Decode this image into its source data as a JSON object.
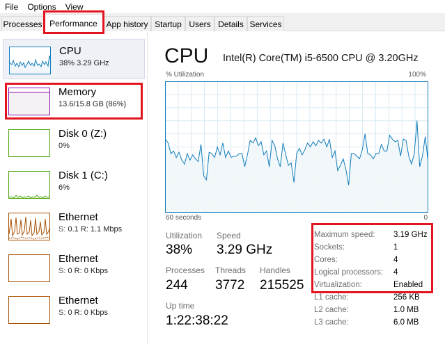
{
  "menu": {
    "items": [
      "File",
      "Options",
      "View"
    ]
  },
  "tabs": [
    "Processes",
    "Performance",
    "App history",
    "Startup",
    "Users",
    "Details",
    "Services"
  ],
  "active_tab": "Performance",
  "sidebar": {
    "items": [
      {
        "name": "CPU",
        "sub_value": "38%  3.29 GHz",
        "sub_label": "",
        "color": "#117dbb"
      },
      {
        "name": "Memory",
        "sub_value": "13.6/15.8 GB (86%)",
        "sub_label": "",
        "color": "#8b12ae"
      },
      {
        "name": "Disk 0 (Z:)",
        "sub_value": "0%",
        "sub_label": "",
        "color": "#4da60c"
      },
      {
        "name": "Disk 1 (C:)",
        "sub_value": "6%",
        "sub_label": "",
        "color": "#4da60c"
      },
      {
        "name": "Ethernet",
        "sub_label": "S:",
        "sub_value": "0.1  R: 1.1 Mbps",
        "color": "#a74f01"
      },
      {
        "name": "Ethernet",
        "sub_label": "S:",
        "sub_value": "0  R: 0 Kbps",
        "color": "#a74f01"
      },
      {
        "name": "Ethernet",
        "sub_label": "S:",
        "sub_value": "0  R: 0 Kbps",
        "color": "#a74f01"
      }
    ]
  },
  "main": {
    "title": "CPU",
    "cpu_model": "Intel(R) Core(TM) i5-6500 CPU @ 3.20GHz",
    "graph": {
      "y_label": "% Utilization",
      "y_max_label": "100%",
      "x_left_label": "60 seconds",
      "x_right_label": "0",
      "line_color": "#117dbb",
      "fill_color": "#f1f6fa",
      "grid_color": "#d9eaf4",
      "values": [
        56,
        53,
        45,
        47,
        42,
        46,
        40,
        37,
        45,
        40,
        44,
        41,
        39,
        52,
        28,
        25,
        46,
        45,
        42,
        50,
        44,
        53,
        42,
        47,
        42,
        43,
        43,
        45,
        45,
        35,
        44,
        55,
        53,
        57,
        51,
        54,
        44,
        47,
        35,
        55,
        51,
        41,
        35,
        53,
        44,
        36,
        38,
        23,
        45,
        49,
        44,
        48,
        53,
        50,
        54,
        51,
        55,
        53,
        56,
        50,
        56,
        42,
        47,
        32,
        36,
        41,
        33,
        21,
        45,
        45,
        43,
        41,
        48,
        60,
        45,
        44,
        41,
        45,
        45,
        52,
        47,
        47,
        59,
        56,
        54,
        55,
        43,
        56,
        55,
        43,
        37,
        45,
        70,
        35,
        43,
        58,
        40
      ]
    },
    "stats": {
      "utilization": {
        "label": "Utilization",
        "value": "38%"
      },
      "speed": {
        "label": "Speed",
        "value": "3.29 GHz"
      },
      "processes": {
        "label": "Processes",
        "value": "244"
      },
      "threads": {
        "label": "Threads",
        "value": "3772"
      },
      "handles": {
        "label": "Handles",
        "value": "215525"
      },
      "uptime": {
        "label": "Up time",
        "value": "1:22:38:22"
      }
    },
    "specs": [
      {
        "key": "Maximum speed:",
        "value": "3.19 GHz"
      },
      {
        "key": "Sockets:",
        "value": "1"
      },
      {
        "key": "Cores:",
        "value": "4"
      },
      {
        "key": "Logical processors:",
        "value": "4"
      },
      {
        "key": "Virtualization:",
        "value": "Enabled"
      },
      {
        "key": "L1 cache:",
        "value": "256 KB"
      },
      {
        "key": "L2 cache:",
        "value": "1.0 MB"
      },
      {
        "key": "L3 cache:",
        "value": "6.0 MB"
      }
    ]
  },
  "highlight_color": "#e1141f"
}
